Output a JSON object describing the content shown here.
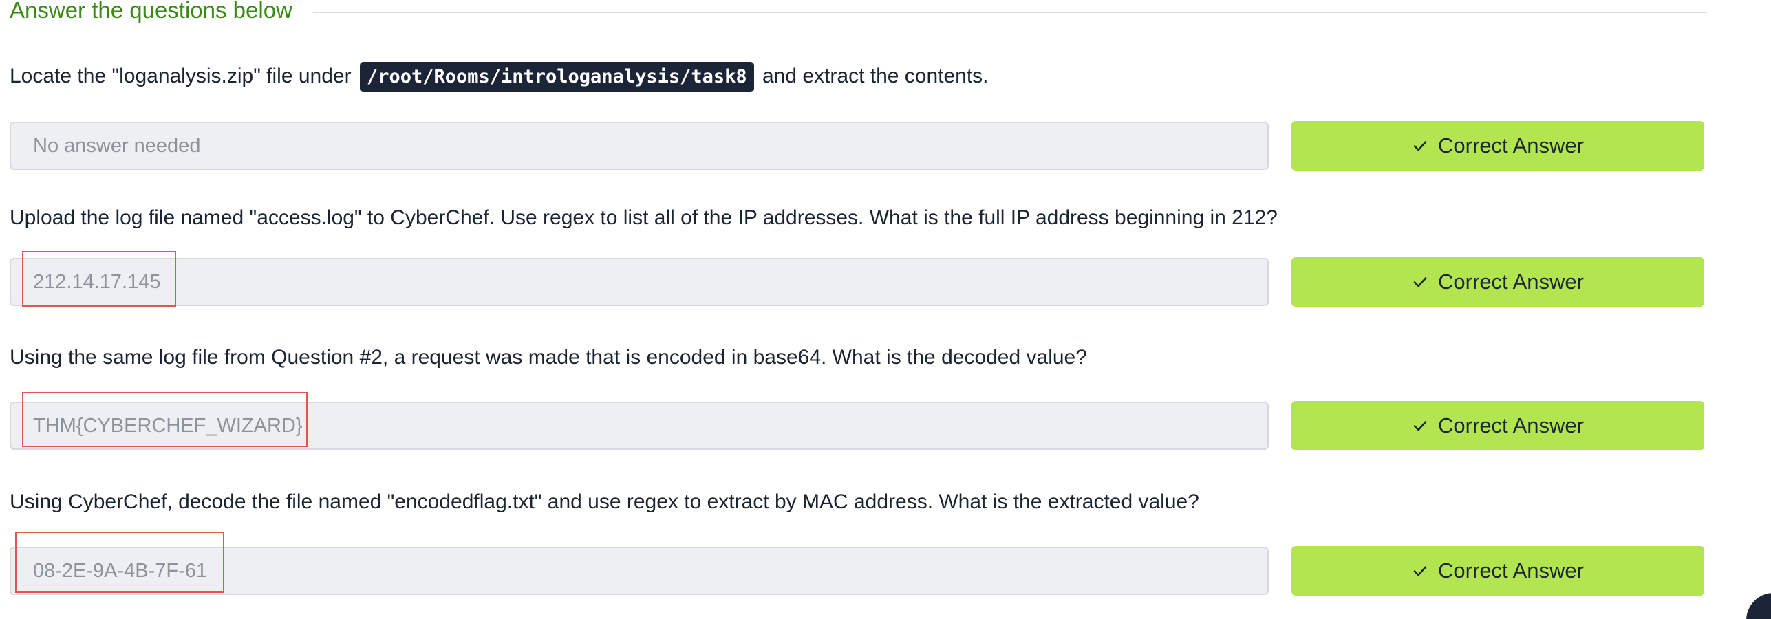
{
  "section": {
    "title": "Answer the questions below"
  },
  "q1": {
    "text_before": "Locate the \"loganalysis.zip\" file under",
    "path": "/root/Rooms/introloganalysis/task8",
    "text_after": "and extract the contents.",
    "placeholder": "No answer needed",
    "value": "",
    "button_label": "Correct Answer"
  },
  "q2": {
    "text": "Upload the log file named \"access.log\" to CyberChef. Use regex to list all of the IP addresses. What is the full IP address beginning in 212?",
    "value": "212.14.17.145",
    "button_label": "Correct Answer"
  },
  "q3": {
    "text": "Using the same log file from Question #2, a request was made that is encoded in base64. What is the decoded value?",
    "value": "THM{CYBERCHEF_WIZARD}",
    "button_label": "Correct Answer"
  },
  "q4": {
    "text": "Using CyberChef, decode the file named \"encodedflag.txt\" and use regex to extract by MAC address. What is the extracted value?",
    "value": "08-2E-9A-4B-7F-61",
    "button_label": "Correct Answer"
  },
  "icons": {
    "button_icon": "check-icon"
  },
  "colors": {
    "section_title": "#3a8a16",
    "button_bg": "#b3e550",
    "code_chip_bg": "#1c2538",
    "input_bg": "#eeeff2",
    "highlight_border": "#e0574f"
  }
}
